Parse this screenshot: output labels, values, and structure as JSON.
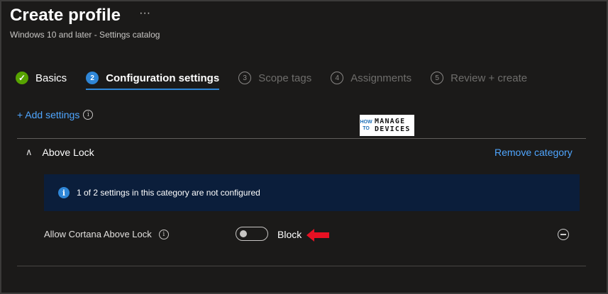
{
  "header": {
    "title": "Create profile",
    "more_label": "···",
    "subtitle": "Windows 10 and later - Settings catalog"
  },
  "steps": [
    {
      "marker": "✓",
      "label": "Basics",
      "state": "done"
    },
    {
      "marker": "2",
      "label": "Configuration settings",
      "state": "active"
    },
    {
      "marker": "3",
      "label": "Scope tags",
      "state": "pending"
    },
    {
      "marker": "4",
      "label": "Assignments",
      "state": "pending"
    },
    {
      "marker": "5",
      "label": "Review + create",
      "state": "pending"
    }
  ],
  "add_settings": {
    "label": "+ Add settings",
    "info_icon": "info-icon"
  },
  "watermark": {
    "how": "HOW",
    "to": "TO",
    "line1": "MANAGE",
    "line2": "DEVICES"
  },
  "category": {
    "title": "Above Lock",
    "chevron": "∧",
    "remove_label": "Remove category",
    "banner_icon": "i",
    "banner_text": "1 of 2 settings in this category are not configured"
  },
  "setting": {
    "label": "Allow Cortana Above Lock",
    "value_label": "Block",
    "toggle_on": false
  },
  "colors": {
    "accent": "#2f86d6",
    "link": "#4fa6ff",
    "success": "#57a300",
    "annotation_arrow": "#e81123"
  }
}
